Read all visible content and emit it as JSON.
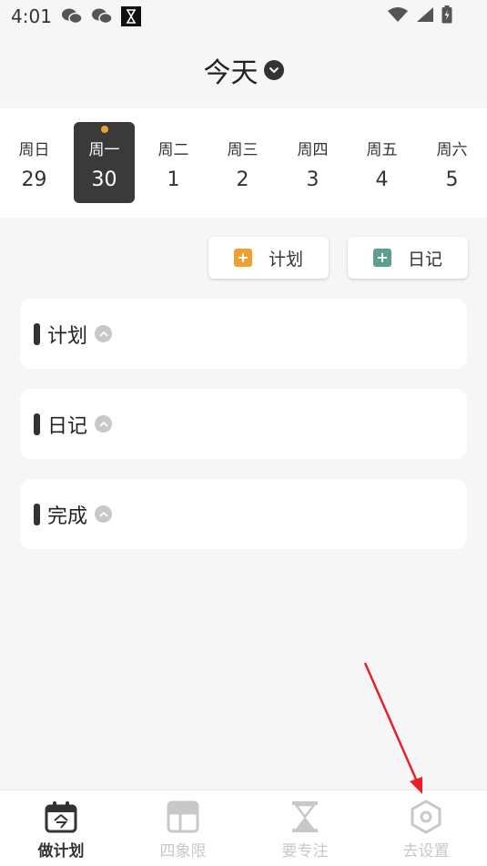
{
  "status_bar": {
    "time": "4:01"
  },
  "header": {
    "title": "今天"
  },
  "week": {
    "days": [
      {
        "name": "周日",
        "num": "29",
        "selected": false,
        "dot": false
      },
      {
        "name": "周一",
        "num": "30",
        "selected": true,
        "dot": true
      },
      {
        "name": "周二",
        "num": "1",
        "selected": false,
        "dot": false
      },
      {
        "name": "周三",
        "num": "2",
        "selected": false,
        "dot": false
      },
      {
        "name": "周四",
        "num": "3",
        "selected": false,
        "dot": false
      },
      {
        "name": "周五",
        "num": "4",
        "selected": false,
        "dot": false
      },
      {
        "name": "周六",
        "num": "5",
        "selected": false,
        "dot": false
      }
    ]
  },
  "actions": {
    "plan_label": "计划",
    "diary_label": "日记",
    "plan_color": "#f0a030",
    "diary_color": "#5e9e8e"
  },
  "sections": {
    "plan": "计划",
    "diary": "日记",
    "done": "完成"
  },
  "nav": {
    "items": [
      {
        "label": "做计划",
        "icon": "calendar-today-icon",
        "active": true
      },
      {
        "label": "四象限",
        "icon": "quadrant-icon",
        "active": false
      },
      {
        "label": "要专注",
        "icon": "hourglass-icon",
        "active": false
      },
      {
        "label": "去设置",
        "icon": "settings-hexagon-icon",
        "active": false
      }
    ]
  },
  "colors": {
    "accent_dark": "#3a3a3a",
    "dot": "#f0a030",
    "annotation_arrow": "#e8202a"
  }
}
